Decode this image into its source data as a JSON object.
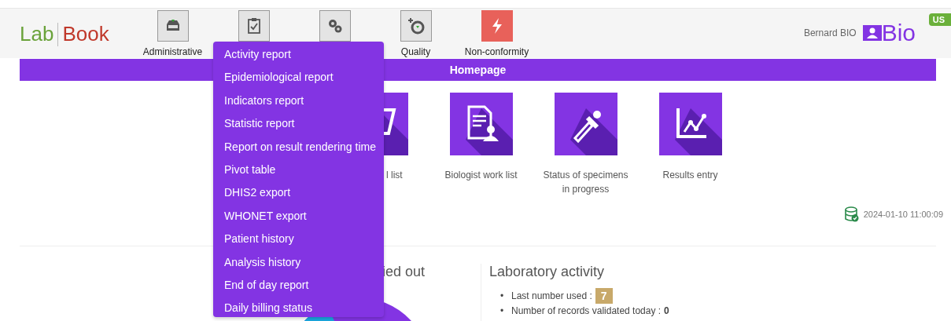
{
  "logo": {
    "left": "Lab",
    "right": "Book"
  },
  "nav": [
    {
      "kind": "inbox",
      "label": "Administrative"
    },
    {
      "kind": "clipboard"
    },
    {
      "kind": "gears"
    },
    {
      "kind": "quality",
      "label": "Quality"
    },
    {
      "kind": "flash",
      "label": "Non-conformity"
    }
  ],
  "user": {
    "name": "Bernard BIO",
    "role": "Bio",
    "language": "US"
  },
  "page_title": "Homepage",
  "tiles": [
    {
      "kind": "basket",
      "label": "l list"
    },
    {
      "kind": "document-person",
      "label": "Biologist work list"
    },
    {
      "kind": "pipette",
      "label": "Status of specimens in progress"
    },
    {
      "kind": "chart",
      "label": "Results entry"
    }
  ],
  "sync_time": "2024-01-10 11:00:09",
  "left_panel": {
    "title": "ied out"
  },
  "lab_activity": {
    "title": "Laboratory activity",
    "items": [
      {
        "marker": "•",
        "label": "Last number used :",
        "value": "7",
        "kind": "badge"
      },
      {
        "marker": "•",
        "label": "Number of records validated today :",
        "value": "0",
        "kind": "bold"
      }
    ]
  },
  "menu": {
    "items": [
      "Activity report",
      "Epidemiological report",
      "Indicators report",
      "Statistic report",
      "Report on result rendering time",
      "Pivot table",
      "DHIS2 export",
      "WHONET export",
      "Patient history",
      "Analysis history",
      "End of day report",
      "Daily billing status"
    ]
  }
}
